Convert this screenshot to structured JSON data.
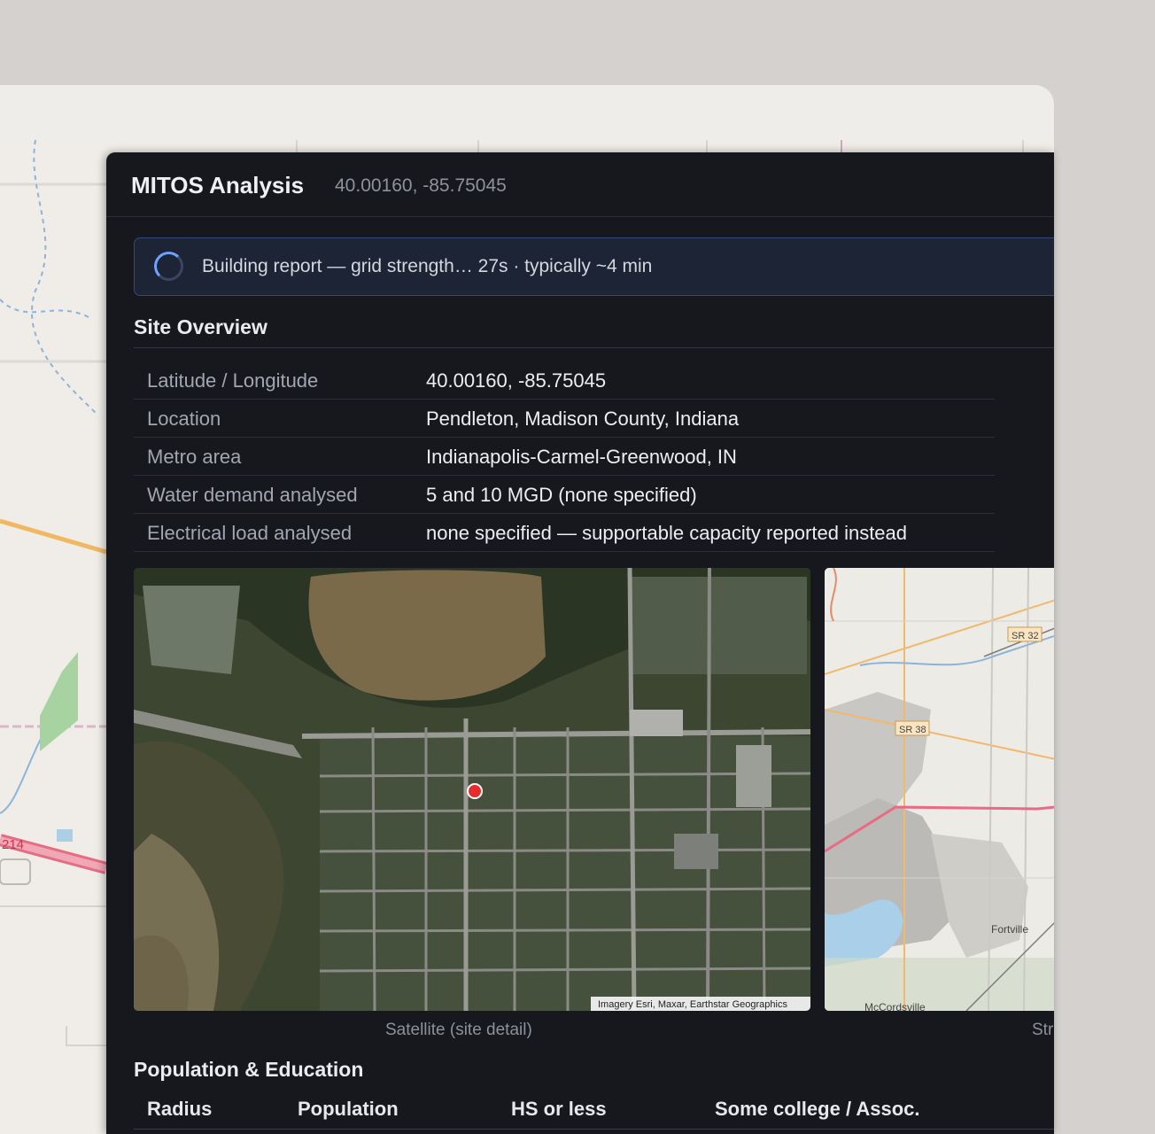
{
  "panel": {
    "title": "MITOS Analysis",
    "coords": "40.00160, -85.75045"
  },
  "progress": {
    "text": "Building report — grid strength… 27s · typically ~4 min"
  },
  "site_overview": {
    "title": "Site Overview",
    "rows": [
      {
        "label": "Latitude / Longitude",
        "value": "40.00160, -85.75045"
      },
      {
        "label": "Location",
        "value": "Pendleton, Madison County, Indiana"
      },
      {
        "label": "Metro area",
        "value": "Indianapolis-Carmel-Greenwood, IN"
      },
      {
        "label": "Water demand analysed",
        "value": "5 and 10 MGD (none specified)"
      },
      {
        "label": "Electrical load analysed",
        "value": "none specified — supportable capacity reported instead"
      }
    ]
  },
  "maps": {
    "satellite": {
      "caption": "Satellite (site detail)",
      "attribution": "Imagery Esri, Maxar, Earthstar Geographics"
    },
    "street": {
      "caption_visible": "Str",
      "labels": {
        "sr32": "SR 32",
        "sr38": "SR 38",
        "fortville": "Fortville",
        "mccordsville": "McCordsville"
      }
    }
  },
  "basemap": {
    "road_shield": "214"
  },
  "population": {
    "title": "Population & Education",
    "columns": [
      "Radius",
      "Population",
      "HS or less",
      "Some college / Assoc."
    ]
  },
  "colors": {
    "panel_bg": "#17181d",
    "accent": "#6ea2ff",
    "site_marker": "#e82b2b"
  }
}
